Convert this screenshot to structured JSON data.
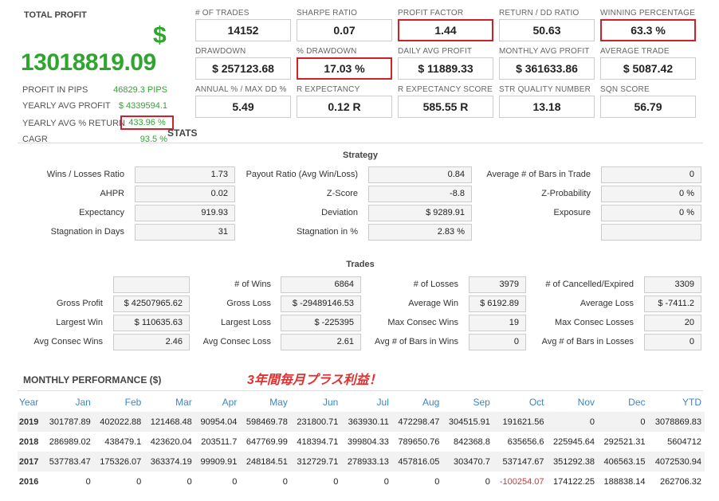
{
  "summary": {
    "total_profit_label": "TOTAL PROFIT",
    "currency_symbol": "$",
    "total_profit_value": "13018819.09",
    "profit_in_pips_label": "PROFIT IN PIPS",
    "profit_in_pips_value": "46829.3 PIPS",
    "yearly_avg_profit_label": "YEARLY AVG PROFIT",
    "yearly_avg_profit_value": "$ 4339594.1",
    "yearly_avg_return_label": "YEARLY AVG % RETURN",
    "yearly_avg_return_value": "433.96 %",
    "cagr_label": "CAGR",
    "cagr_value": "93.5 %"
  },
  "metrics": [
    {
      "label": "# OF TRADES",
      "value": "14152"
    },
    {
      "label": "SHARPE RATIO",
      "value": "0.07"
    },
    {
      "label": "PROFIT FACTOR",
      "value": "1.44"
    },
    {
      "label": "RETURN / DD RATIO",
      "value": "50.63"
    },
    {
      "label": "WINNING PERCENTAGE",
      "value": "63.3 %"
    },
    {
      "label": "DRAWDOWN",
      "value": "$ 257123.68"
    },
    {
      "label": "% DRAWDOWN",
      "value": "17.03 %"
    },
    {
      "label": "DAILY AVG PROFIT",
      "value": "$ 11889.33"
    },
    {
      "label": "MONTHLY AVG PROFIT",
      "value": "$ 361633.86"
    },
    {
      "label": "AVERAGE TRADE",
      "value": "$ 5087.42"
    },
    {
      "label": "ANNUAL % / MAX DD %",
      "value": "5.49"
    },
    {
      "label": "R EXPECTANCY",
      "value": "0.12 R"
    },
    {
      "label": "R EXPECTANCY SCORE",
      "value": "585.55 R"
    },
    {
      "label": "STR QUALITY NUMBER",
      "value": "13.18"
    },
    {
      "label": "SQN SCORE",
      "value": "56.79"
    }
  ],
  "stats_title": "STATS",
  "strategy": {
    "title": "Strategy",
    "rows": [
      [
        {
          "label": "Wins / Losses Ratio",
          "value": "1.73"
        },
        {
          "label": "Payout Ratio (Avg Win/Loss)",
          "value": "0.84"
        },
        {
          "label": "Average # of Bars in Trade",
          "value": "0"
        }
      ],
      [
        {
          "label": "AHPR",
          "value": "0.02"
        },
        {
          "label": "Z-Score",
          "value": "-8.8"
        },
        {
          "label": "Z-Probability",
          "value": "0 %"
        }
      ],
      [
        {
          "label": "Expectancy",
          "value": "919.93"
        },
        {
          "label": "Deviation",
          "value": "$ 9289.91"
        },
        {
          "label": "Exposure",
          "value": "0 %"
        }
      ],
      [
        {
          "label": "Stagnation in Days",
          "value": "31"
        },
        {
          "label": "Stagnation in %",
          "value": "2.83 %"
        },
        {
          "label": "",
          "value": ""
        }
      ]
    ]
  },
  "trades": {
    "title": "Trades",
    "rows": [
      [
        {
          "label": "",
          "value": ""
        },
        {
          "label": "# of Wins",
          "value": "6864"
        },
        {
          "label": "# of Losses",
          "value": "3979"
        },
        {
          "label": "# of Cancelled/Expired",
          "value": "3309"
        }
      ],
      [
        {
          "label": "Gross Profit",
          "value": "$ 42507965.62"
        },
        {
          "label": "Gross Loss",
          "value": "$ -29489146.53"
        },
        {
          "label": "Average Win",
          "value": "$ 6192.89"
        },
        {
          "label": "Average Loss",
          "value": "$ -7411.2"
        }
      ],
      [
        {
          "label": "Largest Win",
          "value": "$ 110635.63"
        },
        {
          "label": "Largest Loss",
          "value": "$ -225395"
        },
        {
          "label": "Max Consec Wins",
          "value": "19"
        },
        {
          "label": "Max Consec Losses",
          "value": "20"
        }
      ],
      [
        {
          "label": "Avg Consec Wins",
          "value": "2.46"
        },
        {
          "label": "Avg Consec Loss",
          "value": "2.61"
        },
        {
          "label": "Avg # of Bars in Wins",
          "value": "0"
        },
        {
          "label": "Avg # of Bars in Losses",
          "value": "0"
        }
      ]
    ]
  },
  "monthly": {
    "title": "MONTHLY PERFORMANCE ($)",
    "annotation": "3年間毎月プラス利益！",
    "headers": [
      "Year",
      "Jan",
      "Feb",
      "Mar",
      "Apr",
      "May",
      "Jun",
      "Jul",
      "Aug",
      "Sep",
      "Oct",
      "Nov",
      "Dec",
      "YTD"
    ],
    "rows": [
      [
        "2019",
        "301787.89",
        "402022.88",
        "121468.48",
        "90954.04",
        "598469.78",
        "231800.71",
        "363930.11",
        "472298.47",
        "304515.91",
        "191621.56",
        "0",
        "0",
        "3078869.83"
      ],
      [
        "2018",
        "286989.02",
        "438479.1",
        "423620.04",
        "203511.7",
        "647769.99",
        "418394.71",
        "399804.33",
        "789650.76",
        "842368.8",
        "635656.6",
        "225945.64",
        "292521.31",
        "5604712"
      ],
      [
        "2017",
        "537783.47",
        "175326.07",
        "363374.19",
        "99909.91",
        "248184.51",
        "312729.71",
        "278933.13",
        "457816.05",
        "303470.7",
        "537147.67",
        "351292.38",
        "406563.15",
        "4072530.94"
      ],
      [
        "2016",
        "0",
        "0",
        "0",
        "0",
        "0",
        "0",
        "0",
        "0",
        "0",
        "-100254.07",
        "174122.25",
        "188838.14",
        "262706.32"
      ]
    ]
  },
  "colors": {
    "positive": "#2fa52f",
    "negative": "#e03030",
    "highlight": "#d0202a",
    "header_blue": "#3b86c6"
  }
}
